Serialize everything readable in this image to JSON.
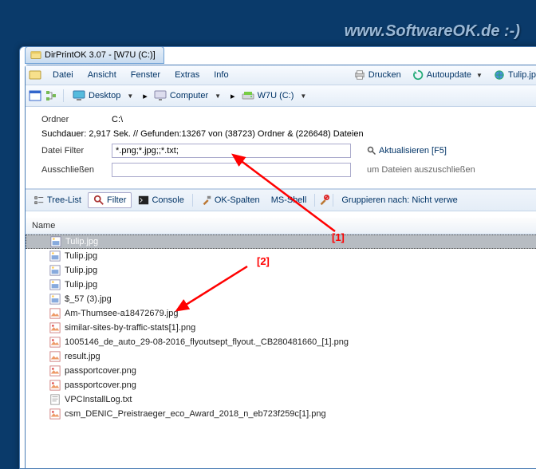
{
  "site_link": "www.SoftwareOK.de :-)",
  "title": "DirPrintOK 3.07  -  [W7U (C:)]",
  "menu": {
    "datei": "Datei",
    "ansicht": "Ansicht",
    "fenster": "Fenster",
    "extras": "Extras",
    "info": "Info",
    "drucken": "Drucken",
    "autoupdate": "Autoupdate",
    "tulip": "Tulip.jp"
  },
  "breadcrumb": {
    "desktop": "Desktop",
    "computer": "Computer",
    "drive": "W7U (C:)"
  },
  "info": {
    "ordner_label": "Ordner",
    "ordner_value": "C:\\",
    "suchdauer": "Suchdauer: 2,917 Sek. //  Gefunden:13267 von (38723) Ordner & (226648) Dateien",
    "filter_label": "Datei Filter",
    "filter_value": "*.png;*.jpg;;*.txt;",
    "aktualisieren": "Aktualisieren [F5]",
    "ausschliessen_label": "Ausschließen",
    "ausschliessen_value": "",
    "ausschliessen_hint": "um Dateien auszuschließen"
  },
  "tabs": {
    "treelist": "Tree-List",
    "filter": "Filter",
    "console": "Console",
    "okspalten": "OK-Spalten",
    "msshell": "MS-Shell",
    "gruppieren_label": "Gruppieren nach:",
    "gruppieren_value": "Nicht verwe"
  },
  "grid": {
    "header_name": "Name",
    "rows": [
      {
        "name": "Tulip.jpg",
        "type": "jpg",
        "selected": true
      },
      {
        "name": "Tulip.jpg",
        "type": "jpg"
      },
      {
        "name": "Tulip.jpg",
        "type": "jpg"
      },
      {
        "name": "Tulip.jpg",
        "type": "jpg"
      },
      {
        "name": "$_57 (3).jpg",
        "type": "jpg"
      },
      {
        "name": "Am-Thumsee-a18472679.jpg",
        "type": "jpg-alt"
      },
      {
        "name": "similar-sites-by-traffic-stats[1].png",
        "type": "png"
      },
      {
        "name": "1005146_de_auto_29-08-2016_flyoutsept_flyout._CB280481660_[1].png",
        "type": "png"
      },
      {
        "name": "result.jpg",
        "type": "jpg-alt"
      },
      {
        "name": "passportcover.png",
        "type": "png"
      },
      {
        "name": "passportcover.png",
        "type": "png"
      },
      {
        "name": "VPCInstallLog.txt",
        "type": "txt"
      },
      {
        "name": "csm_DENIC_Preistraeger_eco_Award_2018_n_eb723f259c[1].png",
        "type": "png"
      }
    ]
  },
  "annotations": {
    "a1": "[1]",
    "a2": "[2]"
  }
}
